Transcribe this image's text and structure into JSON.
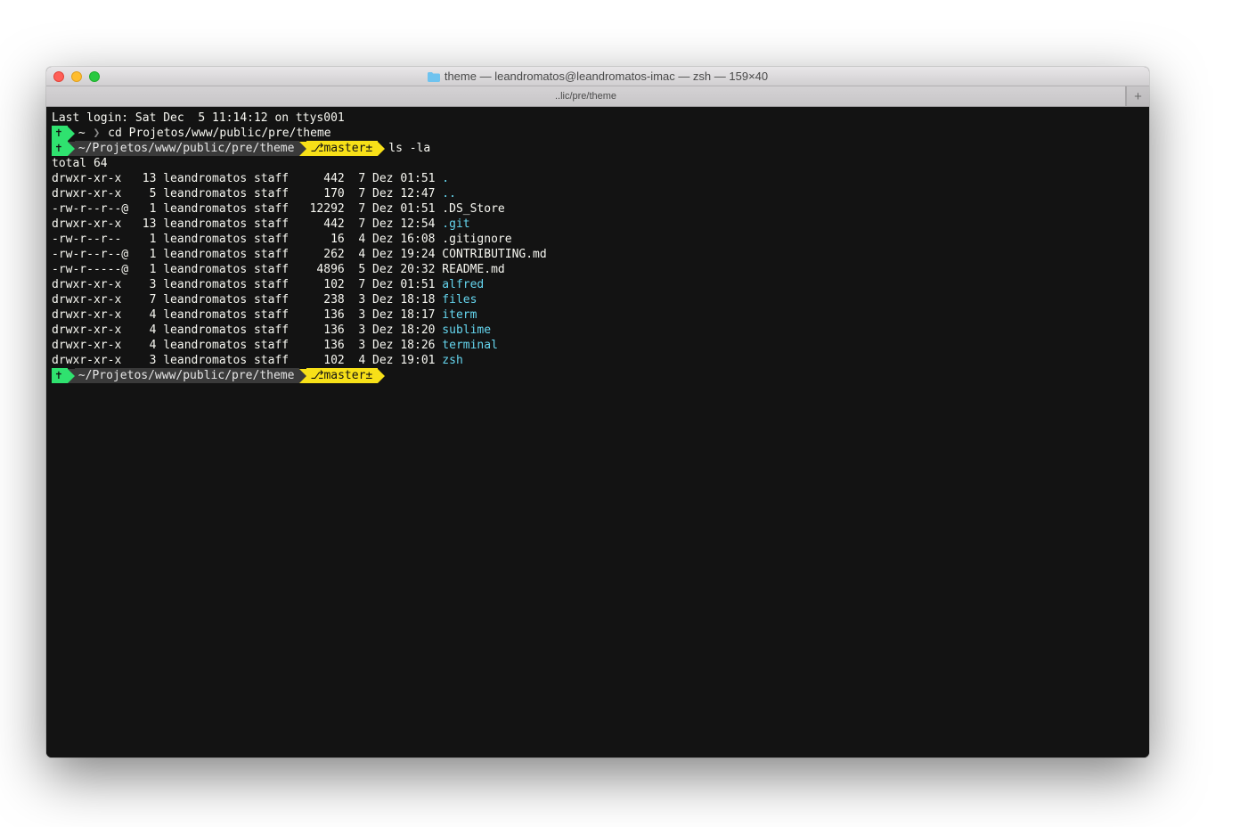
{
  "window": {
    "title": "theme — leandromatos@leandromatos-imac — zsh — 159×40",
    "tab_label": "..lic/pre/theme",
    "new_tab": "+"
  },
  "terminal": {
    "last_login": "Last login: Sat Dec  5 11:14:12 on ttys001",
    "prompt1": {
      "seg1_icon": "✝",
      "path": "~",
      "command": "cd Projetos/www/public/pre/theme"
    },
    "prompt2": {
      "seg1_icon": "✝",
      "path": "~/Projetos/www/public/pre/theme",
      "branch_icon": "⎇",
      "branch": "master±",
      "command": "ls -la"
    },
    "ls_total": "total 64",
    "ls_rows": [
      {
        "perm": "drwxr-xr-x",
        "links": "13",
        "owner": "leandromatos",
        "group": "staff",
        "size": "442",
        "date": "7 Dez 01:51",
        "name": ".",
        "is_dir": true
      },
      {
        "perm": "drwxr-xr-x",
        "links": "5",
        "owner": "leandromatos",
        "group": "staff",
        "size": "170",
        "date": "7 Dez 12:47",
        "name": "..",
        "is_dir": true
      },
      {
        "perm": "-rw-r--r--@",
        "links": "1",
        "owner": "leandromatos",
        "group": "staff",
        "size": "12292",
        "date": "7 Dez 01:51",
        "name": ".DS_Store",
        "is_dir": false
      },
      {
        "perm": "drwxr-xr-x",
        "links": "13",
        "owner": "leandromatos",
        "group": "staff",
        "size": "442",
        "date": "7 Dez 12:54",
        "name": ".git",
        "is_dir": true
      },
      {
        "perm": "-rw-r--r--",
        "links": "1",
        "owner": "leandromatos",
        "group": "staff",
        "size": "16",
        "date": "4 Dez 16:08",
        "name": ".gitignore",
        "is_dir": false
      },
      {
        "perm": "-rw-r--r--@",
        "links": "1",
        "owner": "leandromatos",
        "group": "staff",
        "size": "262",
        "date": "4 Dez 19:24",
        "name": "CONTRIBUTING.md",
        "is_dir": false
      },
      {
        "perm": "-rw-r-----@",
        "links": "1",
        "owner": "leandromatos",
        "group": "staff",
        "size": "4896",
        "date": "5 Dez 20:32",
        "name": "README.md",
        "is_dir": false
      },
      {
        "perm": "drwxr-xr-x",
        "links": "3",
        "owner": "leandromatos",
        "group": "staff",
        "size": "102",
        "date": "7 Dez 01:51",
        "name": "alfred",
        "is_dir": true
      },
      {
        "perm": "drwxr-xr-x",
        "links": "7",
        "owner": "leandromatos",
        "group": "staff",
        "size": "238",
        "date": "3 Dez 18:18",
        "name": "files",
        "is_dir": true
      },
      {
        "perm": "drwxr-xr-x",
        "links": "4",
        "owner": "leandromatos",
        "group": "staff",
        "size": "136",
        "date": "3 Dez 18:17",
        "name": "iterm",
        "is_dir": true
      },
      {
        "perm": "drwxr-xr-x",
        "links": "4",
        "owner": "leandromatos",
        "group": "staff",
        "size": "136",
        "date": "3 Dez 18:20",
        "name": "sublime",
        "is_dir": true
      },
      {
        "perm": "drwxr-xr-x",
        "links": "4",
        "owner": "leandromatos",
        "group": "staff",
        "size": "136",
        "date": "3 Dez 18:26",
        "name": "terminal",
        "is_dir": true
      },
      {
        "perm": "drwxr-xr-x",
        "links": "3",
        "owner": "leandromatos",
        "group": "staff",
        "size": "102",
        "date": "4 Dez 19:01",
        "name": "zsh",
        "is_dir": true
      }
    ],
    "prompt3": {
      "seg1_icon": "✝",
      "path": "~/Projetos/www/public/pre/theme",
      "branch_icon": "⎇",
      "branch": "master±",
      "command": ""
    }
  },
  "colors": {
    "green": "#2fe26f",
    "yellow": "#f7e018",
    "cyan": "#65d6ef",
    "bg_dark": "#131313",
    "seg_dark": "#3a3a3a"
  }
}
